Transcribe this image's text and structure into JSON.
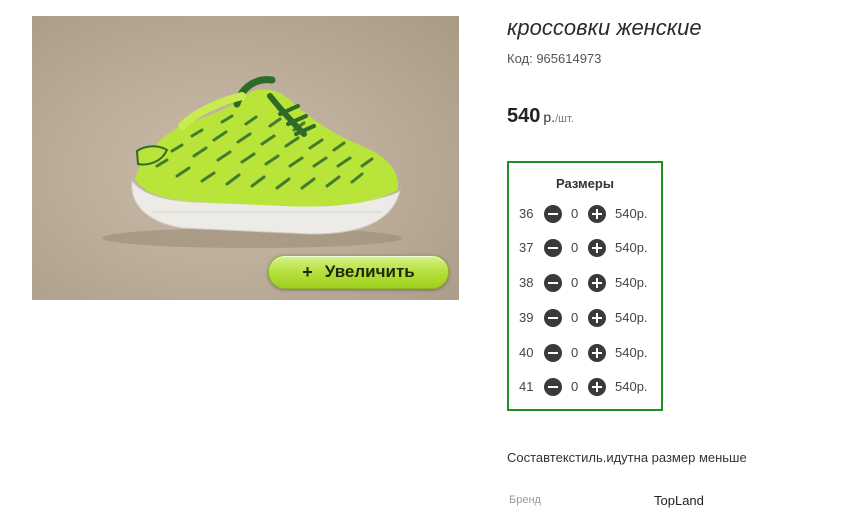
{
  "product": {
    "title": "кроссовки женские",
    "code": "Код: 965614973",
    "image_alt": "green knit sneaker",
    "zoom": {
      "icon": "plus-icon",
      "icon_glyph": "+",
      "label": "Увеличить"
    }
  },
  "price": {
    "amount": "540",
    "currency": "р.",
    "unit": "/шт."
  },
  "sizes": {
    "heading": "Размеры",
    "rows": [
      {
        "size": "36",
        "qty": "0",
        "price": "540р."
      },
      {
        "size": "37",
        "qty": "0",
        "price": "540р."
      },
      {
        "size": "38",
        "qty": "0",
        "price": "540р."
      },
      {
        "size": "39",
        "qty": "0",
        "price": "540р."
      },
      {
        "size": "40",
        "qty": "0",
        "price": "540р."
      },
      {
        "size": "41",
        "qty": "0",
        "price": "540р."
      }
    ]
  },
  "description": "Составтекстиль.идутна размер меньше",
  "attributes": {
    "brand_label": "Бренд",
    "brand_value": "TopLand"
  },
  "colors": {
    "accent_border": "#1f8f1f",
    "zoom_button": "#b6e03c",
    "stepper_icon": "#3a3a3a"
  }
}
